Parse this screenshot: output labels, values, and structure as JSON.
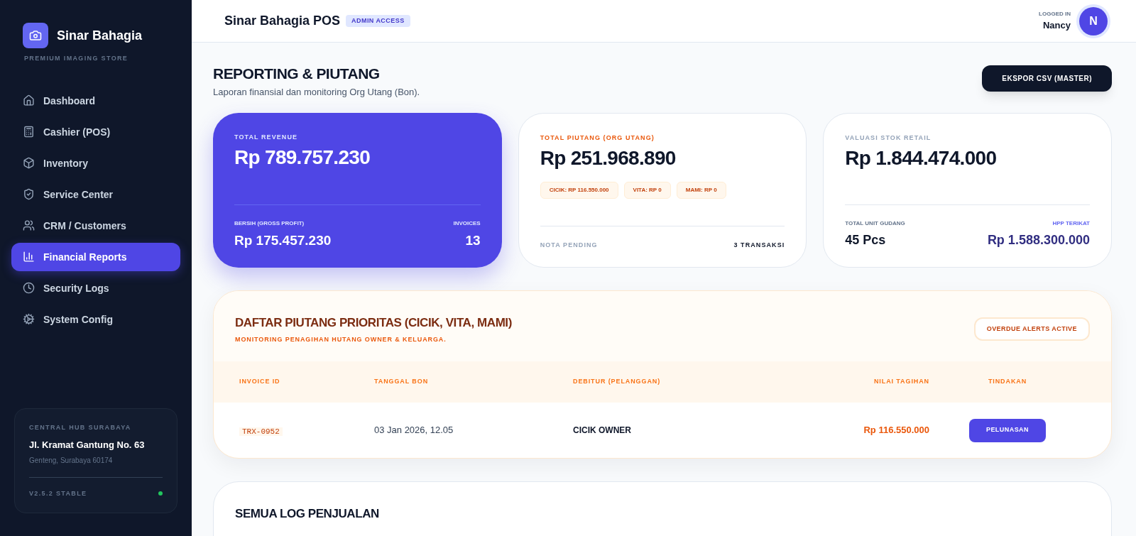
{
  "brand": {
    "name": "Sinar Bahagia",
    "tagline": "PREMIUM IMAGING STORE"
  },
  "nav": [
    {
      "label": "Dashboard",
      "selected": false
    },
    {
      "label": "Cashier (POS)",
      "selected": false
    },
    {
      "label": "Inventory",
      "selected": false
    },
    {
      "label": "Service Center",
      "selected": false
    },
    {
      "label": "CRM / Customers",
      "selected": false
    },
    {
      "label": "Financial Reports",
      "selected": true
    },
    {
      "label": "Security Logs",
      "selected": false
    },
    {
      "label": "System Config",
      "selected": false
    }
  ],
  "branch": {
    "title": "CENTRAL HUB SURABAYA",
    "address": "Jl. Kramat Gantung No. 63",
    "city": "Genteng, Surabaya 60174",
    "version": "V2.5.2 STABLE",
    "online": true
  },
  "header": {
    "title": "Sinar Bahagia POS",
    "badge": "ADMIN ACCESS",
    "user_label": "LOGGED IN",
    "user": "Nancy",
    "avatar": "N"
  },
  "page": {
    "title": "REPORTING & PIUTANG",
    "subtitle": "Laporan finansial dan monitoring Org Utang (Bon).",
    "export": "EKSPOR CSV (MASTER)"
  },
  "revenue": {
    "label": "TOTAL REVENUE",
    "value": "Rp 789.757.230",
    "profit_label": "BERSIH (GROSS PROFIT)",
    "profit": "Rp 175.457.230",
    "invoices_label": "INVOICES",
    "invoices": "13"
  },
  "piutang": {
    "label": "TOTAL PIUTANG (ORG UTANG)",
    "value": "Rp 251.968.890",
    "chips": [
      "CICIK: RP 116.550.000",
      "VITA: RP 0",
      "MAMI: RP 0"
    ],
    "pending_label": "NOTA PENDING",
    "pending": "3 TRANSAKSI"
  },
  "stock": {
    "label": "VALUASI STOK RETAIL",
    "value": "Rp 1.844.474.000",
    "units_label": "TOTAL UNIT GUDANG",
    "units": "45 Pcs",
    "hpp_label": "HPP TERIKAT",
    "hpp": "Rp 1.588.300.000"
  },
  "priority": {
    "title": "DAFTAR PIUTANG PRIORITAS (CICIK, VITA, MAMI)",
    "subtitle": "MONITORING PENAGIHAN HUTANG OWNER & KELUARGA.",
    "alert": "OVERDUE ALERTS ACTIVE",
    "columns": [
      "INVOICE ID",
      "TANGGAL BON",
      "DEBITUR (PELANGGAN)",
      "NILAI TAGIHAN",
      "TINDAKAN"
    ],
    "rows": [
      {
        "id": "TRX-0952",
        "date": "03 Jan 2026, 12.05",
        "debtor": "CICIK OWNER",
        "amount": "Rp 116.550.000",
        "action": "PELUNASAN"
      }
    ]
  },
  "log": {
    "title": "SEMUA LOG PENJUALAN"
  }
}
